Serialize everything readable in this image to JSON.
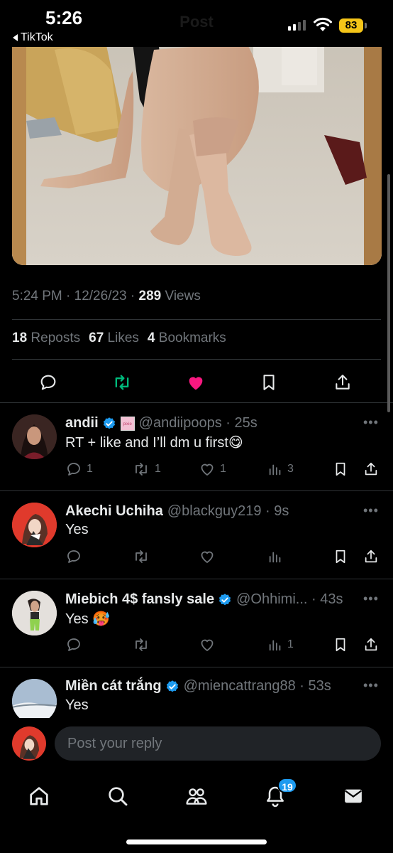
{
  "status_bar": {
    "time": "5:26",
    "back_app": "TikTok",
    "battery": "83",
    "header_title": "Post"
  },
  "post": {
    "timestamp": "5:24 PM · 12/26/23 · ",
    "views_count": "289",
    "views_label": "Views",
    "reposts_count": "18",
    "reposts_label": "Reposts",
    "likes_count": "67",
    "likes_label": "Likes",
    "bookmarks_count": "4",
    "bookmarks_label": "Bookmarks",
    "liked": true,
    "colors": {
      "like": "#f91880",
      "repost": "#00ba7c",
      "verified": "#1d9bf0"
    }
  },
  "replies": [
    {
      "name": "andii",
      "handle": "@andiipoops · 25s",
      "text": "RT + like and I’ll dm u first",
      "emoji": "😋",
      "verified": true,
      "badge_text": "pixie",
      "replies": "1",
      "reposts": "1",
      "likes": "1",
      "views": "3"
    },
    {
      "name": "Akechi Uchiha",
      "handle": "@blackguy219 · 9s",
      "text": "Yes",
      "verified": false,
      "replies": "",
      "reposts": "",
      "likes": "",
      "views": ""
    },
    {
      "name": "Miebich 4$ fansly sale",
      "handle": "@Ohhimi... · 43s",
      "text": "Yes",
      "emoji": "🥵",
      "verified": true,
      "replies": "",
      "reposts": "",
      "likes": "",
      "views": "1"
    },
    {
      "name": "Miền cát trắng",
      "handle": "@miencattrang88 · 53s",
      "text": "Yes",
      "verified": true
    }
  ],
  "composer": {
    "placeholder": "Post your reply"
  },
  "tabbar": {
    "notifications_badge": "19"
  },
  "icons": [
    "back-arrow-icon",
    "signal-icon",
    "wifi-icon",
    "battery-icon",
    "reply-icon",
    "repost-icon",
    "like-icon",
    "bookmark-icon",
    "share-icon",
    "views-icon",
    "more-icon",
    "verified-icon",
    "home-icon",
    "search-icon",
    "communities-icon",
    "notifications-icon",
    "messages-icon"
  ]
}
